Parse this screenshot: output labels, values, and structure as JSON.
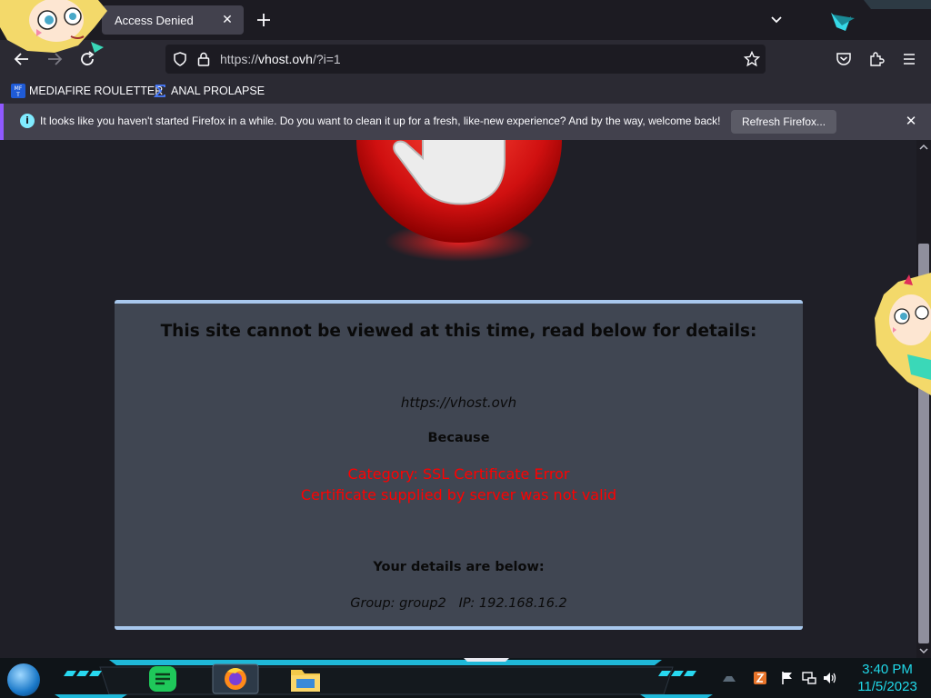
{
  "tab": {
    "title": "Access Denied",
    "close_glyph": "✕"
  },
  "address": {
    "url_prefix": "https://",
    "url_domain": "vhost.ovh",
    "url_suffix": "/?i=1"
  },
  "bookmarks": [
    {
      "label": "MEDIAFIRE ROULETTER",
      "icon": "mediafire-icon"
    },
    {
      "label": "ANAL PROLAPSE",
      "icon": "sigma-icon"
    }
  ],
  "notification": {
    "message": "It looks like you haven't started Firefox in a while. Do you want to clean it up for a fresh, like-new experience? And by the way, welcome back!",
    "button": "Refresh Firefox...",
    "close_glyph": "✕"
  },
  "error_page": {
    "heading": "This site cannot be viewed at this time, read below for details:",
    "url": "https://vhost.ovh",
    "because": "Because",
    "category": "Category: SSL Certificate Error",
    "detail": "Certificate supplied by server was not valid",
    "your_details": "Your details are below:",
    "group_ip": "Group: group2   IP: 192.168.16.2"
  },
  "taskbar": {
    "time": "3:40 PM",
    "date": "11/5/2023"
  },
  "colors": {
    "accent": "#9059ff",
    "error_red": "#ff0000",
    "panel_border": "#a8c8ee",
    "clock": "#20d8e8"
  }
}
